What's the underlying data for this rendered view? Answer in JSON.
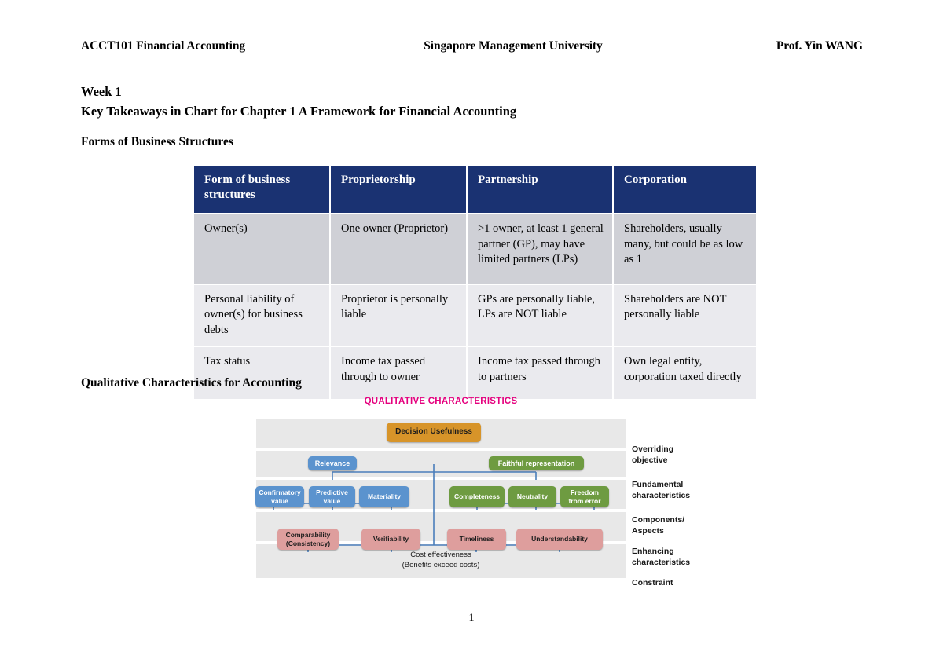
{
  "running_header": {
    "left": "ACCT101 Financial Accounting",
    "center": "Singapore Management University",
    "right": "Prof. Yin WANG"
  },
  "doc": {
    "week": "Week 1",
    "title": "Key Takeaways in Chart for Chapter 1 A Framework for Financial Accounting",
    "section_forms": "Forms of Business Structures",
    "section_qualitative": "Qualitative Characteristics for Accounting",
    "page_number": "1"
  },
  "business_table": {
    "headers": [
      "Form of business structures",
      "Proprietorship",
      "Partnership",
      "Corporation"
    ],
    "rows": [
      {
        "label": "Owner(s)",
        "proprietorship": "One owner (Proprietor)",
        "partnership": ">1 owner, at least 1 general partner (GP), may have limited partners (LPs)",
        "corporation": "Shareholders, usually many, but could be as low as 1"
      },
      {
        "label": "Personal liability of owner(s) for business debts",
        "proprietorship": "Proprietor is personally liable",
        "partnership": "GPs are personally liable, LPs are NOT liable",
        "corporation": "Shareholders are NOT personally liable"
      },
      {
        "label": "Tax status",
        "proprietorship": "Income tax passed through to owner",
        "partnership": "Income tax passed through to partners",
        "corporation": "Own legal entity, corporation taxed directly"
      }
    ],
    "colors": {
      "header_bg": "#1a3272",
      "header_text": "#ffffff",
      "row_shaded_bg": "#cfd0d6",
      "row_light_bg": "#eaeaee"
    }
  },
  "qc_diagram": {
    "title": "QUALITATIVE CHARACTERISTICS",
    "title_color": "#E5007E",
    "band_bg": "#e8e8e8",
    "connector_color": "#4A7EBB",
    "side_labels": [
      "Overriding objective",
      "Fundamental characteristics",
      "Components/ Aspects",
      "Enhancing characteristics",
      "Constraint"
    ],
    "side_labels_lines": [
      [
        "Overriding",
        "objective"
      ],
      [
        "Fundamental",
        "characteristics"
      ],
      [
        "Components/",
        "Aspects"
      ],
      [
        "Enhancing",
        "characteristics"
      ],
      [
        "Constraint",
        ""
      ]
    ],
    "nodes": {
      "overriding": {
        "label": "Decision Usefulness",
        "color": "#D79429"
      },
      "fundamental": [
        {
          "label": "Relevance",
          "color": "#5B93CE"
        },
        {
          "label": "Faithful representation",
          "color": "#6E9B41"
        }
      ],
      "components_relevance": [
        {
          "label": "Confirmatory value",
          "line1": "Confirmatory",
          "line2": "value",
          "color": "#5B93CE"
        },
        {
          "label": "Predictive value",
          "line1": "Predictive",
          "line2": "value",
          "color": "#5B93CE"
        },
        {
          "label": "Materiality",
          "line1": "Materiality",
          "line2": "",
          "color": "#5B93CE"
        }
      ],
      "components_faithful": [
        {
          "label": "Completeness",
          "line1": "Completeness",
          "line2": "",
          "color": "#6E9B41"
        },
        {
          "label": "Neutrality",
          "line1": "Neutrality",
          "line2": "",
          "color": "#6E9B41"
        },
        {
          "label": "Freedom from error",
          "line1": "Freedom",
          "line2": "from error",
          "color": "#6E9B41"
        }
      ],
      "enhancing": [
        {
          "label": "Comparability (Consistency)",
          "line1": "Comparability",
          "line2": "(Consistency)",
          "color": "#DE9E9D"
        },
        {
          "label": "Verifiability",
          "line1": "Verifiability",
          "line2": "",
          "color": "#DE9E9D"
        },
        {
          "label": "Timeliness",
          "line1": "Timeliness",
          "line2": "",
          "color": "#DE9E9D"
        },
        {
          "label": "Understandability",
          "line1": "Understandability",
          "line2": "",
          "color": "#DE9E9D"
        }
      ],
      "constraint": {
        "line1": "Cost effectiveness",
        "line2": "(Benefits exceed costs)"
      }
    }
  }
}
